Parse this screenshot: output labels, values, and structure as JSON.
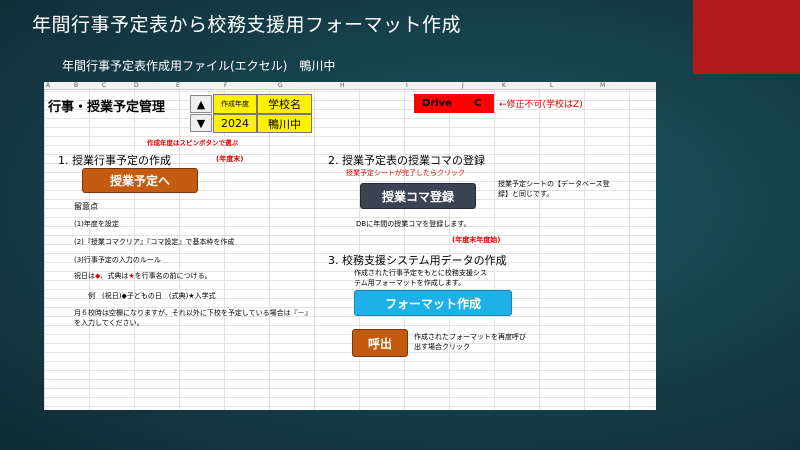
{
  "slide": {
    "title": "年間行事予定表から校務支援用フォーマット作成",
    "subtitle": "年間行事予定表作成用ファイル(エクセル)　鴨川中"
  },
  "sheet": {
    "columns": [
      "A",
      "B",
      "C",
      "D",
      "E",
      "F",
      "G",
      "H",
      "I",
      "J",
      "K",
      "L",
      "M"
    ],
    "title": "行事・授業予定管理",
    "spin_up": "▲",
    "spin_down": "▼",
    "year_label": "作成年度",
    "year_value": "2024",
    "school_label": "学校名",
    "school_value": "鴨川中",
    "drive_label": "Drive",
    "drive_value": "C",
    "drive_note": "←修正不可(学校はZ)",
    "year_hint": "作成年度はスピンボタンで選ぶ",
    "section1": {
      "title": "1. 授業行事予定の作成",
      "tag": "(年度末)",
      "button": "授業予定へ",
      "notes_heading": "留意点",
      "note1": "(1)年度を設定",
      "note2": "(2)『授業コマクリア』『コマ設定』で基本枠を作成",
      "note3": "(3)行事予定の入力のルール",
      "rule_prefix": "祝日は",
      "rule_mark1": "◆",
      "rule_mid": "、式典は",
      "rule_mark2": "★",
      "rule_suffix": "を行事名の前につける。",
      "example": "例　(祝日)◆子どもの日　(式典)★入学式",
      "note4": "月６校時は空欄になりますが、それ以外に下校を予定している場合は『－』を入力してください。"
    },
    "section2": {
      "title": "2. 授業予定表の授業コマの登録",
      "hint": "授業予定シートが完了したらクリック",
      "button": "授業コマ登録",
      "side_note": "授業予定シートの【データベース登録】と同じです。",
      "db_note": "DBに年間の授業コマを登録します。",
      "tag": "(年度末年度始)"
    },
    "section3": {
      "title": "3. 校務支援システム用データの作成",
      "desc": "作成された行事予定をもとに校務支援システム用フォーマットを作成します。",
      "button": "フォーマット作成",
      "call_button": "呼出",
      "call_note": "作成されたフォーマットを再度呼び出す場合クリック"
    }
  },
  "colors": {
    "background": "#17424d",
    "accent": "#b01a1a",
    "orange_button": "#c55a11",
    "dark_button": "#3b4453",
    "blue_button": "#1fb0e8",
    "yellow_cell": "#fff100",
    "red_cell": "#ff0000"
  }
}
